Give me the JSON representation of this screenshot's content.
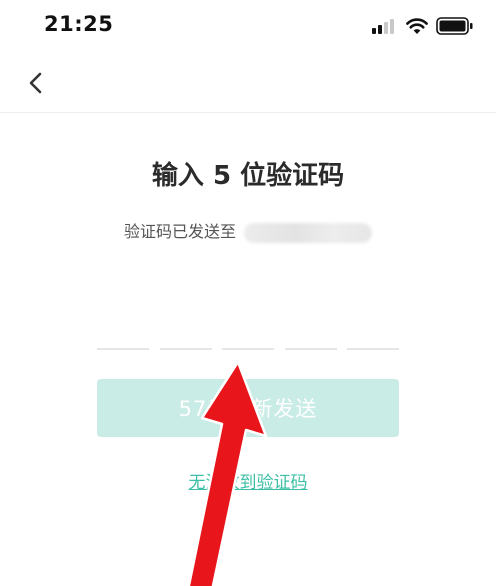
{
  "status_bar": {
    "time": "21:25"
  },
  "header": {
    "back_icon": "chevron-left-icon"
  },
  "main": {
    "title": "输入 5 位验证码",
    "sent_to_label": "验证码已发送至",
    "code_length": 5,
    "resend_button_label": "57后重新发送",
    "help_link": "无法收到验证码"
  },
  "colors": {
    "accent": "#3cbfa6",
    "button_disabled_bg": "#c9ece6",
    "annotation_arrow": "#e8151b"
  }
}
